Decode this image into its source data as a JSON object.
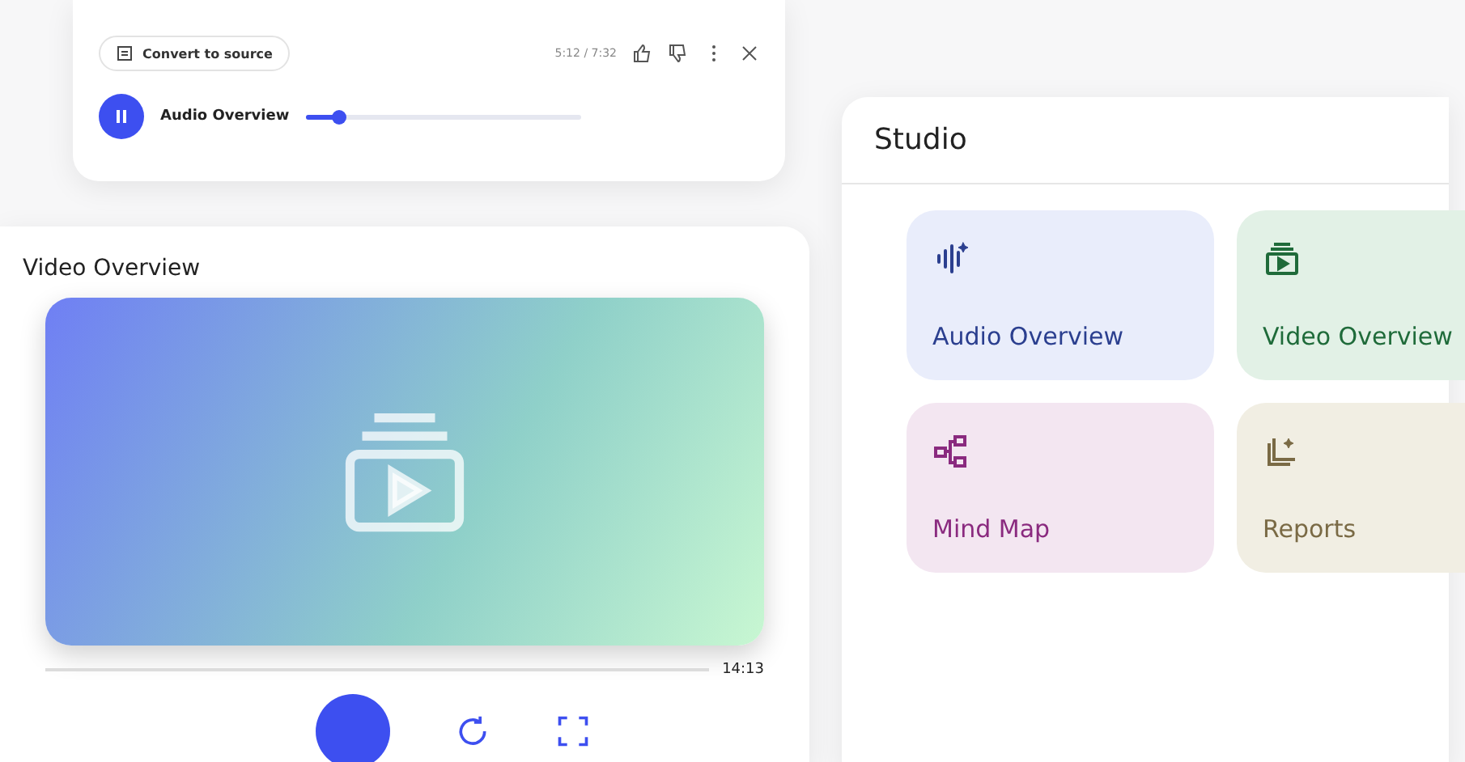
{
  "audio_player": {
    "convert_button": "Convert to source",
    "time": "5:12 / 7:32",
    "playing": true,
    "title": "Audio Overview",
    "level": 0.12
  },
  "video_overview": {
    "title": "Video Overview",
    "duration": "14:13"
  },
  "studio": {
    "title": "Studio",
    "tiles": [
      {
        "kind": "audio",
        "label": "Audio Overview",
        "color": "#2b3f8f"
      },
      {
        "kind": "video",
        "label": "Video Overview",
        "color": "#1f6b3a"
      },
      {
        "kind": "mindmap",
        "label": "Mind Map",
        "color": "#8a2a7f"
      },
      {
        "kind": "reports",
        "label": "Reports",
        "color": "#7a6a45"
      }
    ]
  }
}
